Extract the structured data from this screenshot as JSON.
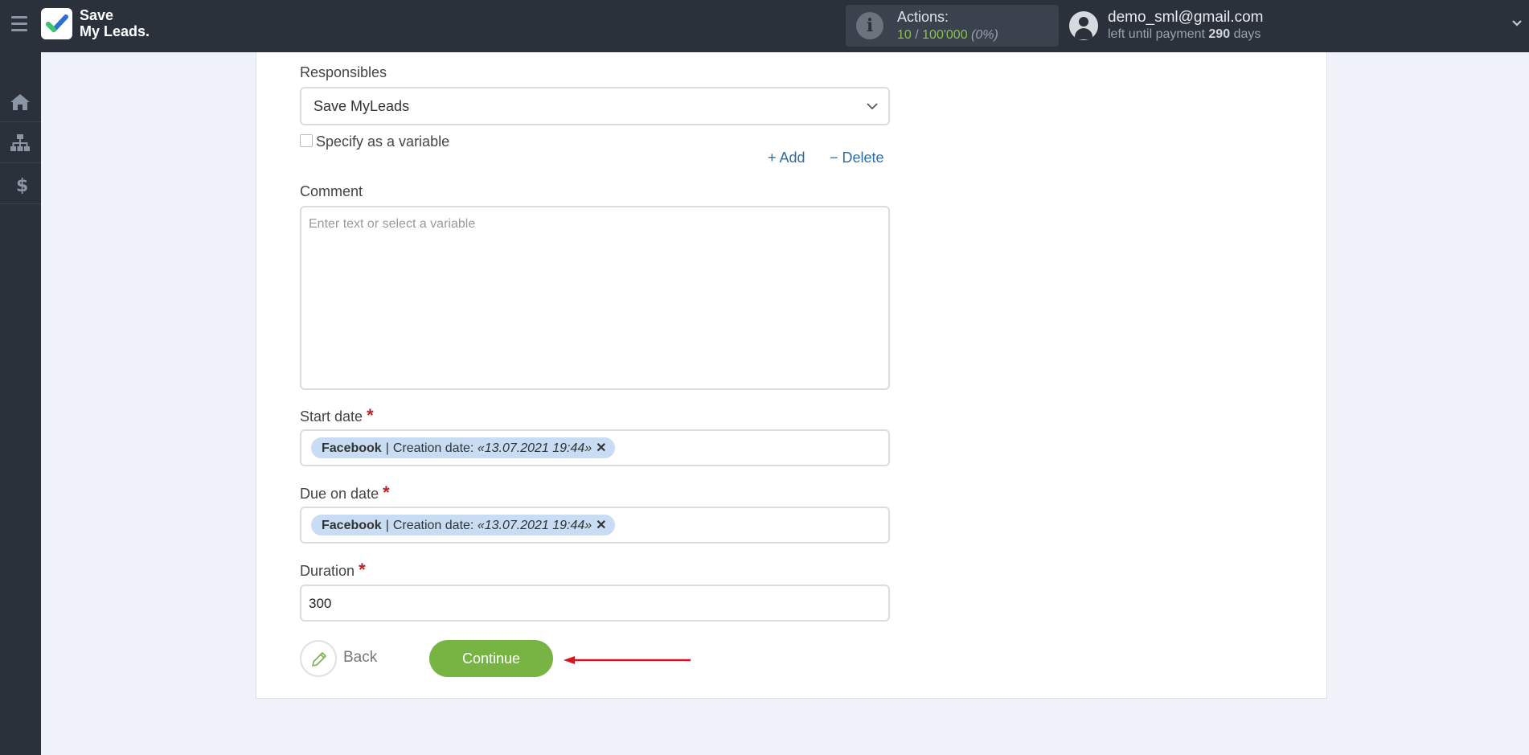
{
  "header": {
    "logo_line1": "Save",
    "logo_line2": "My Leads.",
    "actions_label": "Actions:",
    "actions_used": "10",
    "actions_sep": " / ",
    "actions_total": "100'000",
    "actions_pct": "(0%)",
    "user_email": "demo_sml@gmail.com",
    "payment_prefix": "left until payment",
    "payment_days": "290",
    "payment_suffix": "days"
  },
  "sidebar": {
    "items": [
      {
        "icon": "home-icon"
      },
      {
        "icon": "sitemap-icon"
      },
      {
        "icon": "dollar-icon"
      }
    ]
  },
  "form": {
    "responsibles_label": "Responsibles",
    "responsibles_value": "Save MyLeads",
    "specify_variable_label": "Specify as a variable",
    "add_label": "+ Add",
    "delete_label": "− Delete",
    "comment_label": "Comment",
    "comment_placeholder": "Enter text or select a variable",
    "start_date_label": "Start date",
    "start_date_tag": {
      "source": "Facebook",
      "sep": "|",
      "field": "Creation date:",
      "value": "«13.07.2021 19:44»"
    },
    "due_date_label": "Due on date",
    "due_date_tag": {
      "source": "Facebook",
      "sep": "|",
      "field": "Creation date:",
      "value": "«13.07.2021 19:44»"
    },
    "duration_label": "Duration",
    "duration_value": "300",
    "required_mark": "*",
    "back_label": "Back",
    "continue_label": "Continue"
  },
  "colors": {
    "topbar": "#2a313b",
    "accent_green": "#78b443",
    "link_blue": "#2e6da4",
    "tag_bg": "#c8ddf3",
    "arrow_red": "#d9141c"
  }
}
